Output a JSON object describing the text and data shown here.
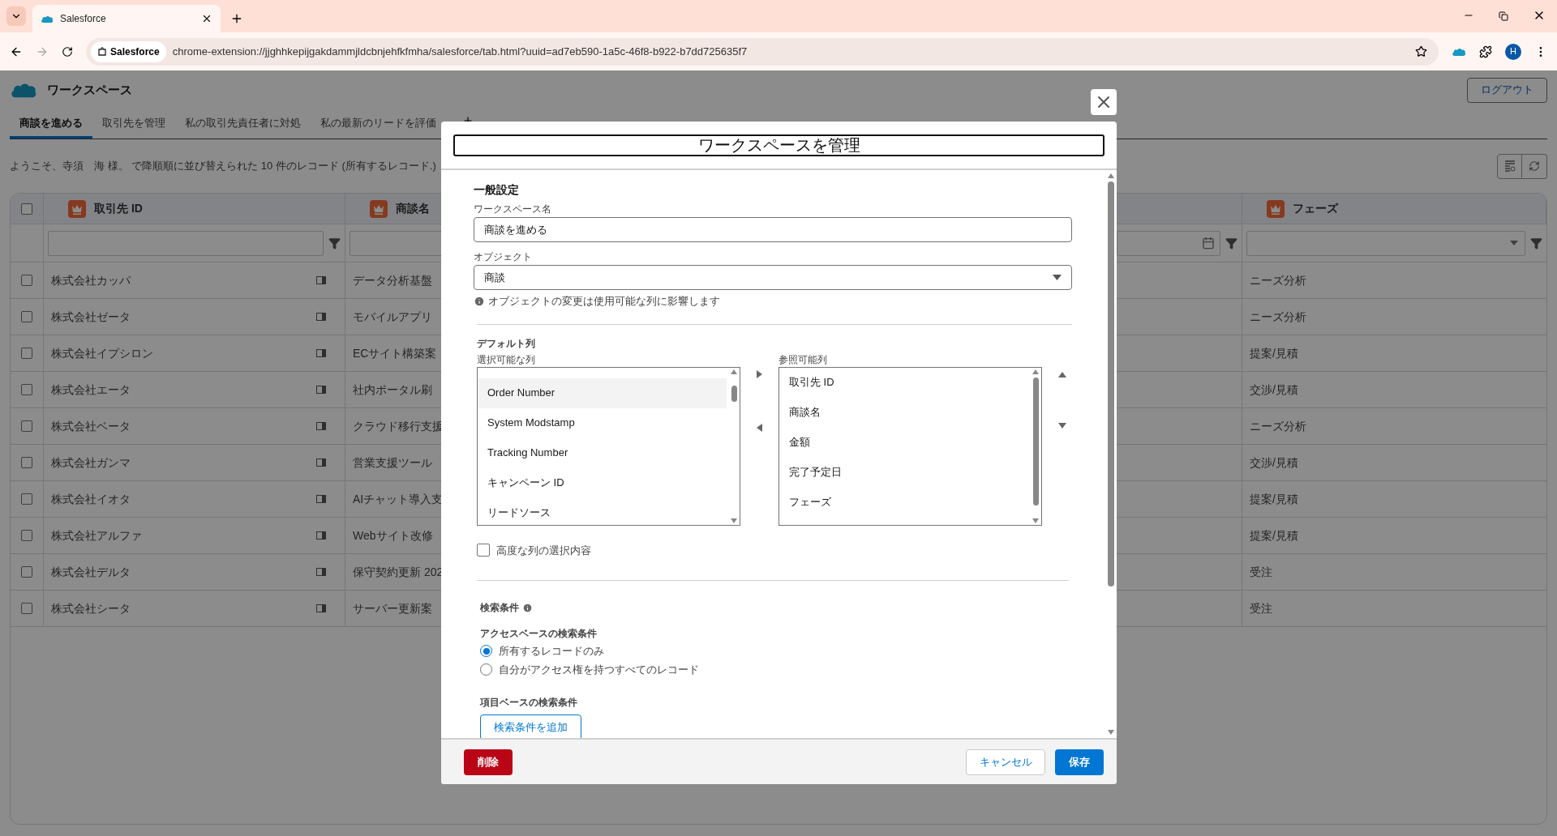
{
  "browser": {
    "tab_title": "Salesforce",
    "site_chip": "Salesforce",
    "url": "chrome-extension://jjghhkepijgakdammjldcbnjehfkfmha/salesforce/tab.html?uuid=ad7eb590-1a5c-46f8-b922-b7dd725635f7",
    "profile_initial": "H"
  },
  "app": {
    "title": "ワークスペース",
    "logout": "ログアウト"
  },
  "tabs": [
    {
      "label": "商談を進める",
      "selected": true,
      "kind": "tab"
    },
    {
      "label": "取引先を管理",
      "selected": false,
      "kind": "tab"
    },
    {
      "label": "私の取引先責任者に対処",
      "selected": false,
      "kind": "tab"
    },
    {
      "label": "私の最新のリードを評価",
      "selected": false,
      "kind": "tab"
    }
  ],
  "summary": "ようこそ、寺須　海 様。 で降順順に並び替えられた 10 件のレコード (所有するレコード.)",
  "table": {
    "select_all_checked": false,
    "columns": [
      {
        "label": "取引先 ID",
        "kind": "text"
      },
      {
        "label": "商談名",
        "kind": "text"
      },
      {
        "kind": "date"
      },
      {
        "label": "フェーズ",
        "kind": "picklist"
      }
    ],
    "rows": [
      {
        "checked": false,
        "account": "株式会社カッパ",
        "opportunity": "データ分析基盤",
        "phase": "ニーズ分析"
      },
      {
        "checked": false,
        "account": "株式会社ゼータ",
        "opportunity": "モバイルアプリ",
        "phase": "ニーズ分析"
      },
      {
        "checked": false,
        "account": "株式会社イプシロン",
        "opportunity": "ECサイト構築案",
        "phase": "提案/見積"
      },
      {
        "checked": false,
        "account": "株式会社エータ",
        "opportunity": "社内ポータル刷",
        "phase": "交渉/見積"
      },
      {
        "checked": false,
        "account": "株式会社ベータ",
        "opportunity": "クラウド移行支援",
        "phase": "ニーズ分析"
      },
      {
        "checked": false,
        "account": "株式会社ガンマ",
        "opportunity": "営業支援ツール",
        "phase": "交渉/見積"
      },
      {
        "checked": false,
        "account": "株式会社イオタ",
        "opportunity": "AIチャット導入支",
        "phase": "提案/見積"
      },
      {
        "checked": false,
        "account": "株式会社アルファ",
        "opportunity": "Webサイト改修",
        "phase": "提案/見積"
      },
      {
        "checked": false,
        "account": "株式会社デルタ",
        "opportunity": "保守契約更新 202",
        "phase": "受注"
      },
      {
        "checked": false,
        "account": "株式会社シータ",
        "opportunity": "サーバー更新案",
        "phase": "受注"
      }
    ]
  },
  "modal": {
    "title": "ワークスペースを管理",
    "general_heading": "一般設定",
    "name_label": "ワークスペース名",
    "name_value": "商談を進める",
    "object_label": "オブジェクト",
    "object_value": "商談",
    "object_note": "オブジェクトの変更は使用可能な列に影響します",
    "columns_heading": "デフォルト列",
    "available_label": "選択可能な列",
    "available": [
      {
        "label": "Order Number",
        "selected": true
      },
      {
        "label": "System Modstamp",
        "selected": false
      },
      {
        "label": "Tracking Number",
        "selected": false
      },
      {
        "label": "キャンペーン ID",
        "selected": false
      },
      {
        "label": "リードソース",
        "selected": false
      }
    ],
    "visible_label": "参照可能列",
    "visible": [
      {
        "label": "取引先 ID",
        "selected": false
      },
      {
        "label": "商談名",
        "selected": false
      },
      {
        "label": "金額",
        "selected": false
      },
      {
        "label": "完了予定日",
        "selected": false
      },
      {
        "label": "フェーズ",
        "selected": false
      }
    ],
    "advanced": {
      "label": "高度な列の選択内容",
      "checked": false
    },
    "filters_heading": "検索条件",
    "access_heading": "アクセスベースの検索条件",
    "access_options": [
      {
        "label": "所有するレコードのみ",
        "selected": true
      },
      {
        "label": "自分がアクセス権を持つすべてのレコード",
        "selected": false
      }
    ],
    "field_heading": "項目ベースの検索条件",
    "add_filter": "検索条件を追加",
    "delete": "削除",
    "cancel": "キャンセル",
    "save": "保存"
  }
}
